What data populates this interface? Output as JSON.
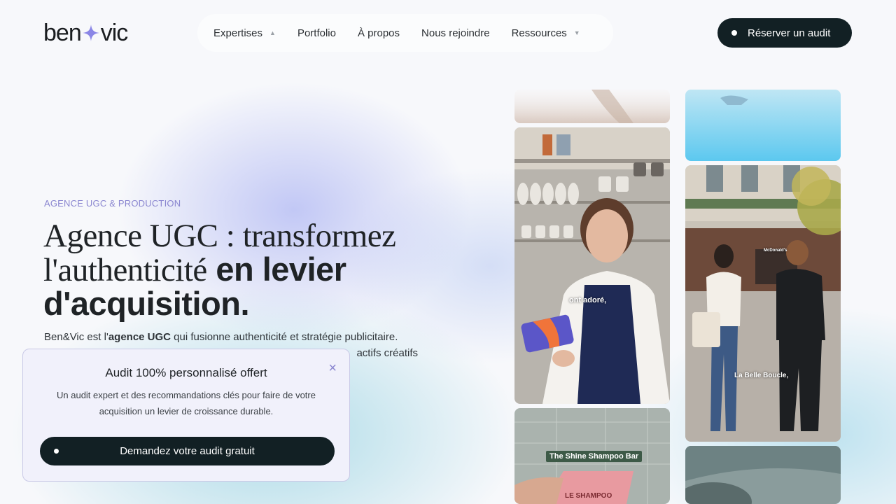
{
  "header": {
    "logo_left": "ben",
    "logo_right": "vic",
    "nav": [
      {
        "label": "Expertises",
        "chevron": "▲"
      },
      {
        "label": "Portfolio"
      },
      {
        "label": "À propos"
      },
      {
        "label": "Nous rejoindre"
      },
      {
        "label": "Ressources",
        "chevron": "▼"
      }
    ],
    "cta_label": "Réserver un audit"
  },
  "hero": {
    "eyebrow": "AGENCE UGC & PRODUCTION",
    "title_serif": "Agence UGC : transformez l'authenticité",
    "title_sans": "en levier d'acquisition.",
    "desc_prefix": "Ben&Vic est l'",
    "desc_bold": "agence UGC",
    "desc_suffix": " qui fusionne authenticité et stratégie publicitaire.",
    "desc_line2": "actifs créatifs"
  },
  "popup": {
    "title": "Audit 100% personnalisé offert",
    "text": "Un audit expert et des recommandations clés pour faire de votre acquisition un levier de croissance durable.",
    "button": "Demandez votre audit gratuit",
    "close_icon": "×"
  },
  "gallery": {
    "caption_kitchen": "ont adoré,",
    "caption_street": "La Belle Boucle,",
    "tag_shampoo": "The Shine Shampoo Bar",
    "street_sign": "McDonald's",
    "box_text": "LE SHAMPOO"
  },
  "colors": {
    "accent": "#8a86d0",
    "dark": "#122024"
  }
}
